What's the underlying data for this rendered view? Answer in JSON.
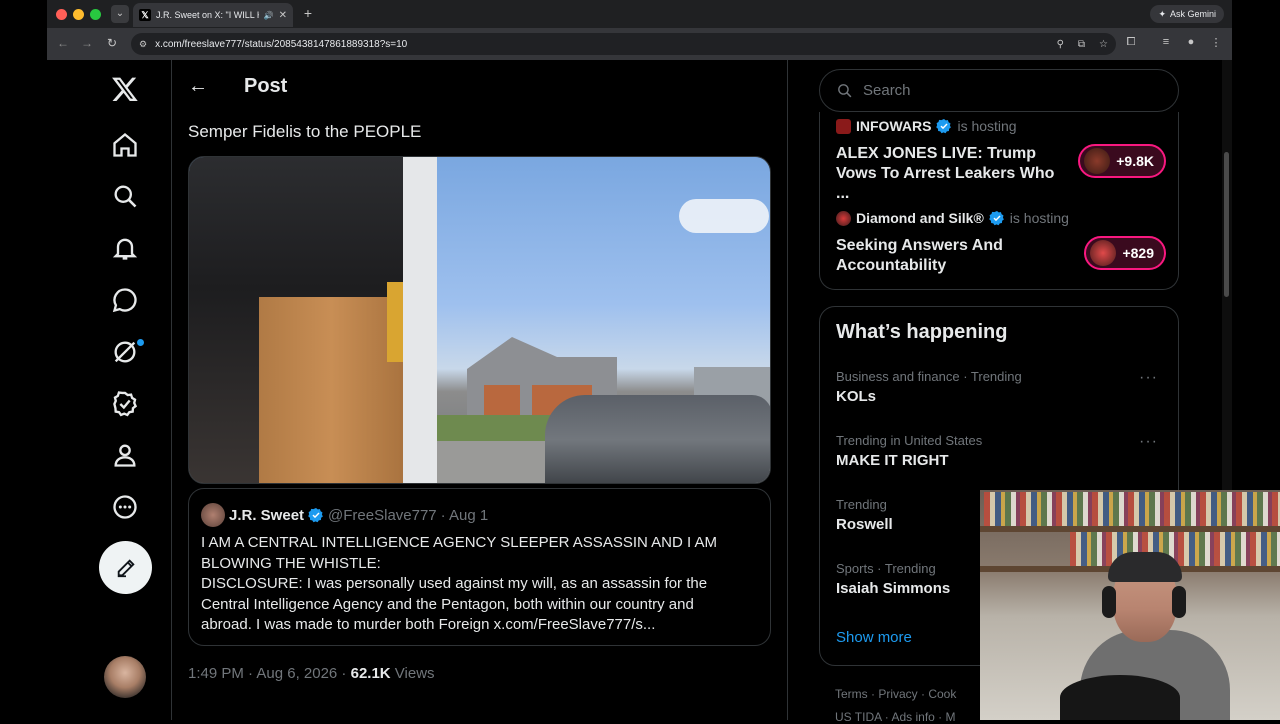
{
  "browser": {
    "tab_title": "J.R. Sweet on X: \"I WILL H",
    "url": "x.com/freeslave777/status/2085438147861889318?s=10",
    "ask_gemini": "Ask Gemini"
  },
  "header": {
    "title": "Post"
  },
  "post": {
    "text": "Semper Fidelis to the PEOPLE",
    "time": "1:49 PM · Aug 6, 2026 · ",
    "views_count": "62.1K",
    "views_label": " Views"
  },
  "quote": {
    "name": "J.R. Sweet",
    "handle": "@FreeSlave777",
    "date": "· Aug 1",
    "lines": [
      "I AM A CENTRAL INTELLIGENCE AGENCY SLEEPER ASSASSIN AND I AM",
      "BLOWING THE WHISTLE:",
      "DISCLOSURE: I was personally used against my will, as an assassin for the",
      "Central Intelligence Agency and the Pentagon, both within our country and",
      "abroad. I was made to murder both Foreign x.com/FreeSlave777/s..."
    ]
  },
  "search": {
    "placeholder": "Search"
  },
  "spaces": [
    {
      "host": "INFOWARS",
      "hosting": "is hosting",
      "title": "ALEX JONES LIVE: Trump Vows To Arrest Leakers Who ...",
      "listeners": "+9.8K"
    },
    {
      "host": "Diamond and Silk®",
      "hosting": "is hosting",
      "title": "Seeking Answers And Accountability",
      "listeners": "+829"
    }
  ],
  "happening": {
    "title": "What’s happening",
    "trends": [
      {
        "context": "Business and finance · Trending",
        "name": "KOLs"
      },
      {
        "context": "Trending in United States",
        "name": "MAKE IT RIGHT"
      },
      {
        "context": "Trending",
        "name": "Roswell"
      },
      {
        "context": "Sports · Trending",
        "name": "Isaiah Simmons"
      }
    ],
    "show_more": "Show more"
  },
  "footer": {
    "line1": "Terms  ·  Privacy  ·  Cook",
    "line2": "US TIDA  ·  Ads info  ·  M"
  },
  "colors": {
    "accent": "#1d9bf0",
    "live_pink": "#f91880"
  }
}
